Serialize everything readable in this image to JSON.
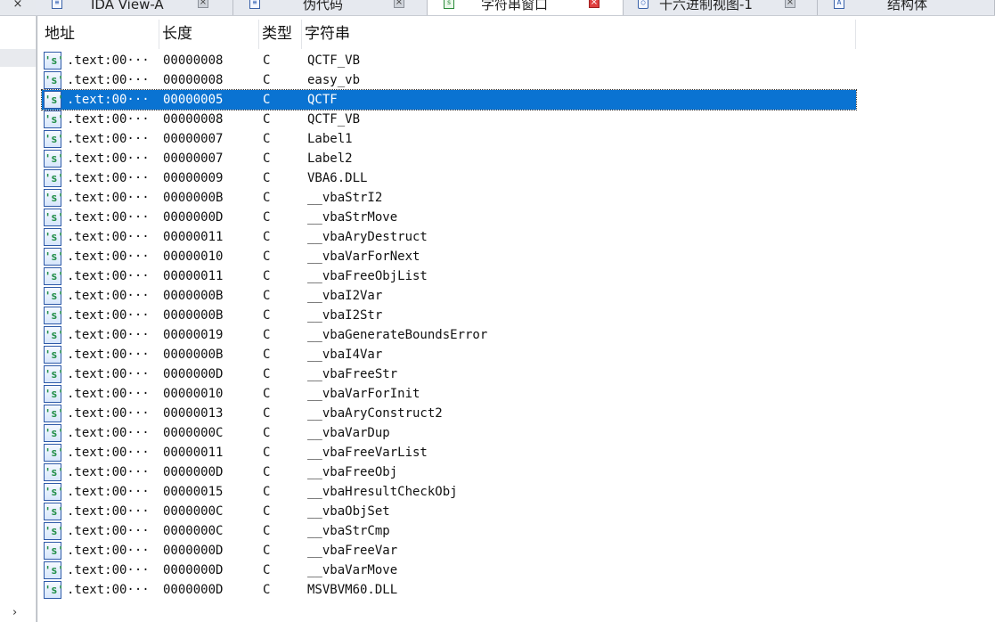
{
  "tabs": [
    {
      "label": "IDA View-A",
      "icon": "document-icon",
      "active": false
    },
    {
      "label": "伪代码",
      "icon": "document-icon",
      "active": false
    },
    {
      "label": "字符串窗口",
      "icon": "strings-icon",
      "active": true
    },
    {
      "label": "十六进制视图-1",
      "icon": "hex-view-icon",
      "active": false
    },
    {
      "label": "结构体",
      "icon": "structure-icon",
      "active": false
    }
  ],
  "corner_glyph": "×",
  "gutter_chevron": "›",
  "columns": [
    "地址",
    "长度",
    "类型",
    "字符串"
  ],
  "row_icon_glyph": "'s'",
  "rows": [
    {
      "addr": ".text:00···",
      "len": "00000008",
      "type": "C",
      "str": "QCTF_VB"
    },
    {
      "addr": ".text:00···",
      "len": "00000008",
      "type": "C",
      "str": "easy_vb"
    },
    {
      "addr": ".text:00···",
      "len": "00000005",
      "type": "C",
      "str": "QCTF"
    },
    {
      "addr": ".text:00···",
      "len": "00000008",
      "type": "C",
      "str": "QCTF_VB"
    },
    {
      "addr": ".text:00···",
      "len": "00000007",
      "type": "C",
      "str": "Label1"
    },
    {
      "addr": ".text:00···",
      "len": "00000007",
      "type": "C",
      "str": "Label2"
    },
    {
      "addr": ".text:00···",
      "len": "00000009",
      "type": "C",
      "str": "VBA6.DLL"
    },
    {
      "addr": ".text:00···",
      "len": "0000000B",
      "type": "C",
      "str": "__vbaStrI2"
    },
    {
      "addr": ".text:00···",
      "len": "0000000D",
      "type": "C",
      "str": "__vbaStrMove"
    },
    {
      "addr": ".text:00···",
      "len": "00000011",
      "type": "C",
      "str": "__vbaAryDestruct"
    },
    {
      "addr": ".text:00···",
      "len": "00000010",
      "type": "C",
      "str": "__vbaVarForNext"
    },
    {
      "addr": ".text:00···",
      "len": "00000011",
      "type": "C",
      "str": "__vbaFreeObjList"
    },
    {
      "addr": ".text:00···",
      "len": "0000000B",
      "type": "C",
      "str": "__vbaI2Var"
    },
    {
      "addr": ".text:00···",
      "len": "0000000B",
      "type": "C",
      "str": "__vbaI2Str"
    },
    {
      "addr": ".text:00···",
      "len": "00000019",
      "type": "C",
      "str": "__vbaGenerateBoundsError"
    },
    {
      "addr": ".text:00···",
      "len": "0000000B",
      "type": "C",
      "str": "__vbaI4Var"
    },
    {
      "addr": ".text:00···",
      "len": "0000000D",
      "type": "C",
      "str": "__vbaFreeStr"
    },
    {
      "addr": ".text:00···",
      "len": "00000010",
      "type": "C",
      "str": "__vbaVarForInit"
    },
    {
      "addr": ".text:00···",
      "len": "00000013",
      "type": "C",
      "str": "__vbaAryConstruct2"
    },
    {
      "addr": ".text:00···",
      "len": "0000000C",
      "type": "C",
      "str": "__vbaVarDup"
    },
    {
      "addr": ".text:00···",
      "len": "00000011",
      "type": "C",
      "str": "__vbaFreeVarList"
    },
    {
      "addr": ".text:00···",
      "len": "0000000D",
      "type": "C",
      "str": "__vbaFreeObj"
    },
    {
      "addr": ".text:00···",
      "len": "00000015",
      "type": "C",
      "str": "__vbaHresultCheckObj"
    },
    {
      "addr": ".text:00···",
      "len": "0000000C",
      "type": "C",
      "str": "__vbaObjSet"
    },
    {
      "addr": ".text:00···",
      "len": "0000000C",
      "type": "C",
      "str": "__vbaStrCmp"
    },
    {
      "addr": ".text:00···",
      "len": "0000000D",
      "type": "C",
      "str": "__vbaFreeVar"
    },
    {
      "addr": ".text:00···",
      "len": "0000000D",
      "type": "C",
      "str": "__vbaVarMove"
    },
    {
      "addr": ".text:00···",
      "len": "0000000D",
      "type": "C",
      "str": "MSVBVM60.DLL"
    }
  ],
  "selected_row": 2,
  "colors": {
    "selection": "#0a73d2",
    "tab_bar": "#dfe3ea",
    "close_active": "#e04040"
  }
}
